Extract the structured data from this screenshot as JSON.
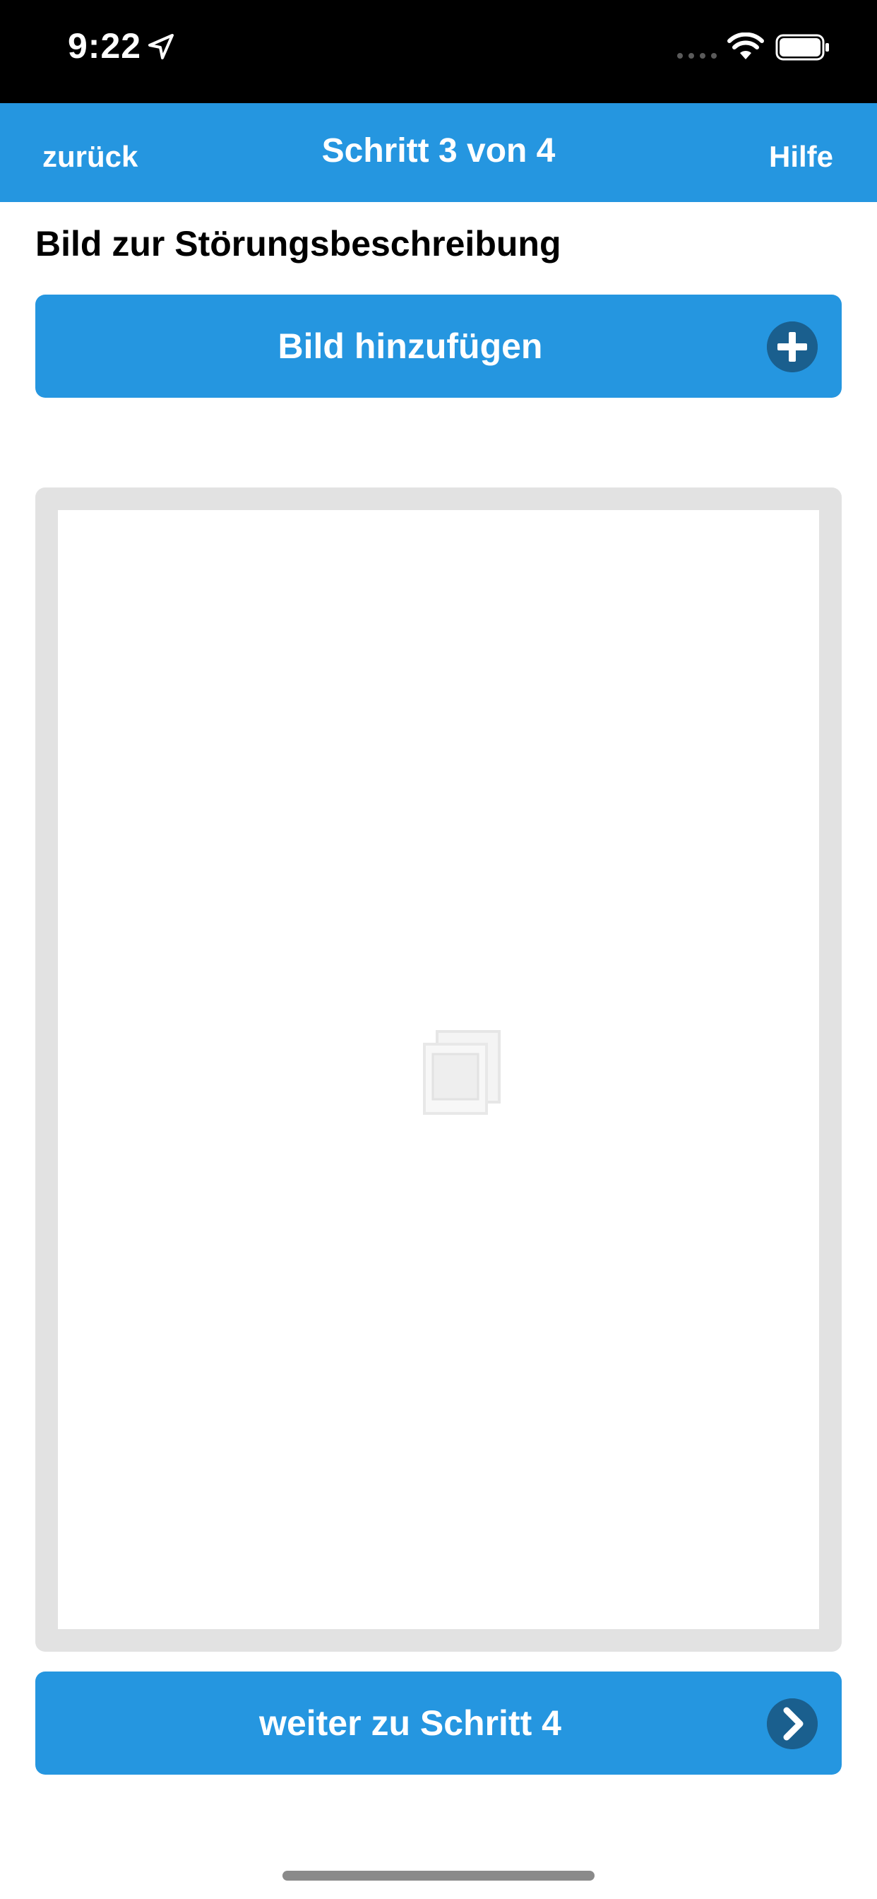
{
  "status_bar": {
    "time": "9:22",
    "location_icon": "location-arrow-icon",
    "signal_icon": "cellular-signal-icon",
    "wifi_icon": "wifi-icon",
    "battery_icon": "battery-icon"
  },
  "nav": {
    "back_label": "zurück",
    "title": "Schritt 3 von 4",
    "help_label": "Hilfe"
  },
  "section": {
    "title": "Bild zur Störungsbeschreibung"
  },
  "add_image_button": {
    "label": "Bild hinzufügen",
    "icon": "plus-circle-icon"
  },
  "preview": {
    "placeholder_icon": "image-placeholder-icon"
  },
  "next_button": {
    "label": "weiter zu Schritt 4",
    "icon": "chevron-right-circle-icon"
  },
  "colors": {
    "accent": "#2596e0",
    "icon_circle": "#1a5f8e",
    "frame_gray": "#e2e2e2",
    "status_bar": "#000000"
  }
}
